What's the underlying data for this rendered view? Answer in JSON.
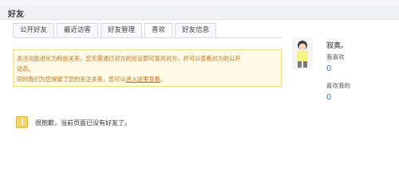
{
  "header": {
    "title": "好友"
  },
  "tabs": [
    {
      "label": "公开好友"
    },
    {
      "label": "最近访客"
    },
    {
      "label": "好友管理"
    },
    {
      "label": "喜欢"
    },
    {
      "label": "好友信息"
    }
  ],
  "notice": {
    "line1": "关注功能进化为粉丝关系，您无需通过对方的验证即可喜欢对方，并可以查看对方的公开",
    "line2": "动态。",
    "line3_prefix": "同时我们为您保留了您的关注关系，您可以",
    "line3_link": "进入这里查看",
    "line3_suffix": "。"
  },
  "profile": {
    "name": "寂寞。",
    "i_like_label": "我喜欢",
    "i_like_count": "0",
    "likes_me_label": "喜欢我的",
    "likes_me_count": "0"
  },
  "empty": {
    "message": "很抱歉，当前页面已没有好友了。"
  },
  "colors": {
    "accent": "#3c7fc6",
    "notice_bg": "#fffbe6",
    "notice_text": "#c8701a"
  }
}
